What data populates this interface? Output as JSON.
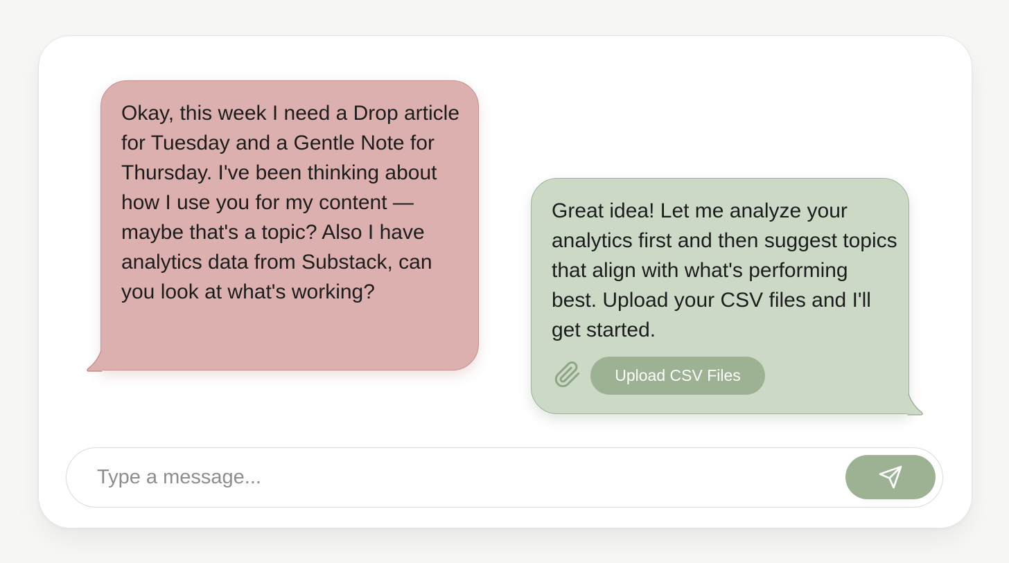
{
  "conversation": {
    "user_message": "Okay, this week I need a Drop article for Tuesday and a Gentle Note for Thursday. I've been thinking about how I use you for my content — maybe that's a topic? Also I have analytics data from Substack, can you look at what's working?",
    "assistant_message": "Great idea! Let me analyze your analytics first and then suggest topics that align with what's performing best. Upload your CSV files and I'll get started.",
    "upload_button_label": "Upload CSV Files",
    "attach_icon": "paperclip-icon"
  },
  "composer": {
    "placeholder": "Type a message...",
    "value": "",
    "send_icon": "send-icon"
  },
  "colors": {
    "user_bubble": "#dcb0ae",
    "assistant_bubble": "#ccd9c6",
    "accent_green": "#9db293",
    "background": "#ffffff"
  }
}
